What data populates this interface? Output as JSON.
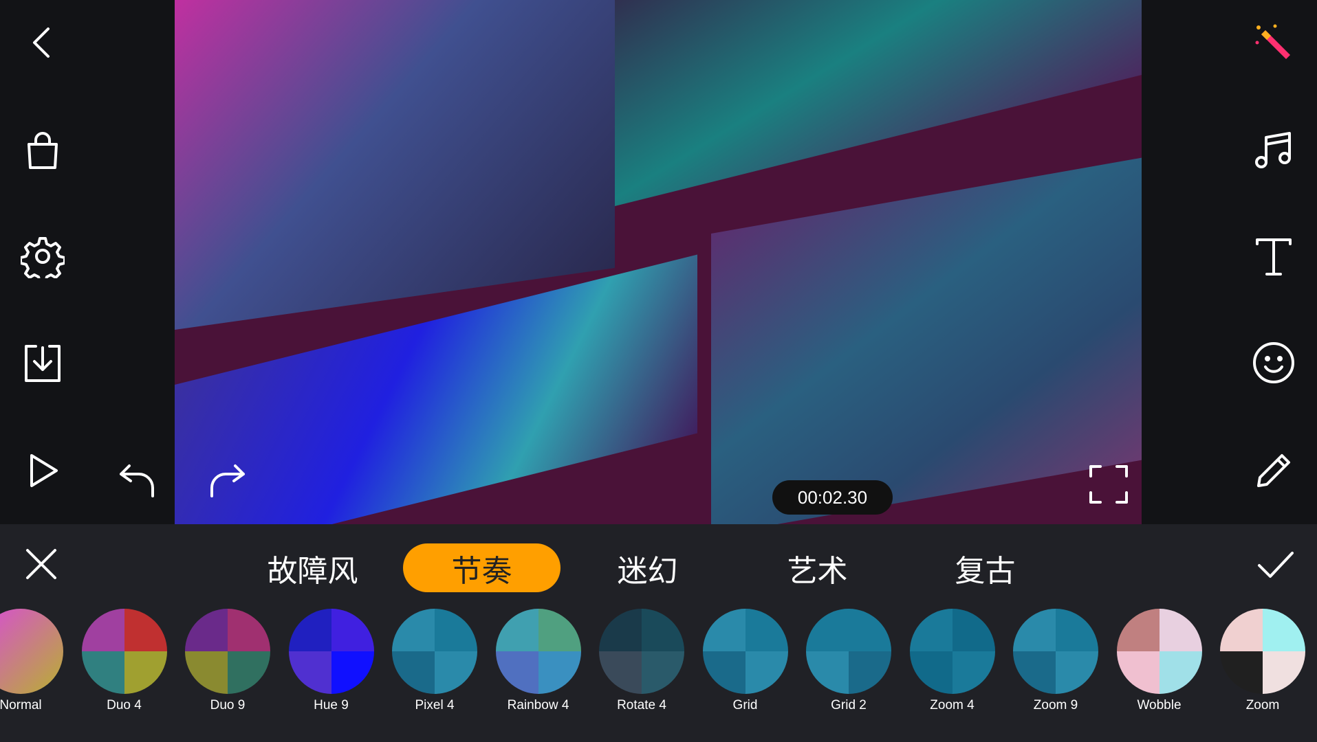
{
  "player": {
    "time": "00:02.30"
  },
  "left_toolbar": [
    "back-icon",
    "shopping-bag-icon",
    "gear-icon",
    "download-icon",
    "play-icon"
  ],
  "right_toolbar": [
    "magic-wand-icon",
    "music-icon",
    "text-icon",
    "smiley-icon",
    "pencil-icon"
  ],
  "categories": {
    "active": "节奏",
    "items": [
      "故障风",
      "节奏",
      "迷幻",
      "艺术",
      "复古"
    ]
  },
  "effects": [
    {
      "label": "Normal",
      "colors": [
        "#d84bd8",
        "#b8b030"
      ]
    },
    {
      "label": "Duo 4",
      "colors": [
        "#c03030",
        "#a0a030",
        "#308080",
        "#a040a0"
      ]
    },
    {
      "label": "Duo 9",
      "colors": [
        "#a03070",
        "#307060",
        "#8a8a30",
        "#6a2a8a"
      ]
    },
    {
      "label": "Hue 9",
      "colors": [
        "#4020e0",
        "#1010ff",
        "#5030d0",
        "#2020c0"
      ]
    },
    {
      "label": "Pixel 4",
      "colors": [
        "#1a7a9a",
        "#2a8aaa",
        "#1a6a8a",
        "#2a8aaa"
      ]
    },
    {
      "label": "Rainbow 4",
      "colors": [
        "#50a080",
        "#3a90c0",
        "#5070c0",
        "#40a0b0"
      ]
    },
    {
      "label": "Rotate 4",
      "colors": [
        "#1a4a5a",
        "#2a5a6a",
        "#3a4a5a",
        "#1a3a4a"
      ]
    },
    {
      "label": "Grid",
      "colors": [
        "#1a7a9a",
        "#2a8aaa",
        "#1a6a8a",
        "#2a8aaa"
      ]
    },
    {
      "label": "Grid 2",
      "colors": [
        "#1a7a9a",
        "#1a6a8a",
        "#2a8aaa",
        "#1a7a9a"
      ]
    },
    {
      "label": "Zoom 4",
      "colors": [
        "#116a8a",
        "#1a7a9a",
        "#116a8a",
        "#1a7a9a"
      ]
    },
    {
      "label": "Zoom 9",
      "colors": [
        "#1a7a9a",
        "#2a8aaa",
        "#1a6a8a",
        "#2a8aaa"
      ]
    },
    {
      "label": "Wobble",
      "colors": [
        "#e8d0e0",
        "#a0e0e8",
        "#f0c0d0",
        "#c08080"
      ]
    },
    {
      "label": "Zoom",
      "colors": [
        "#a0f0f0",
        "#f0e0e0",
        "#202020",
        "#f0d0d0"
      ]
    }
  ],
  "colors": {
    "accent": "#ff9f00",
    "panel": "#202126",
    "sidebar": "#121316"
  }
}
